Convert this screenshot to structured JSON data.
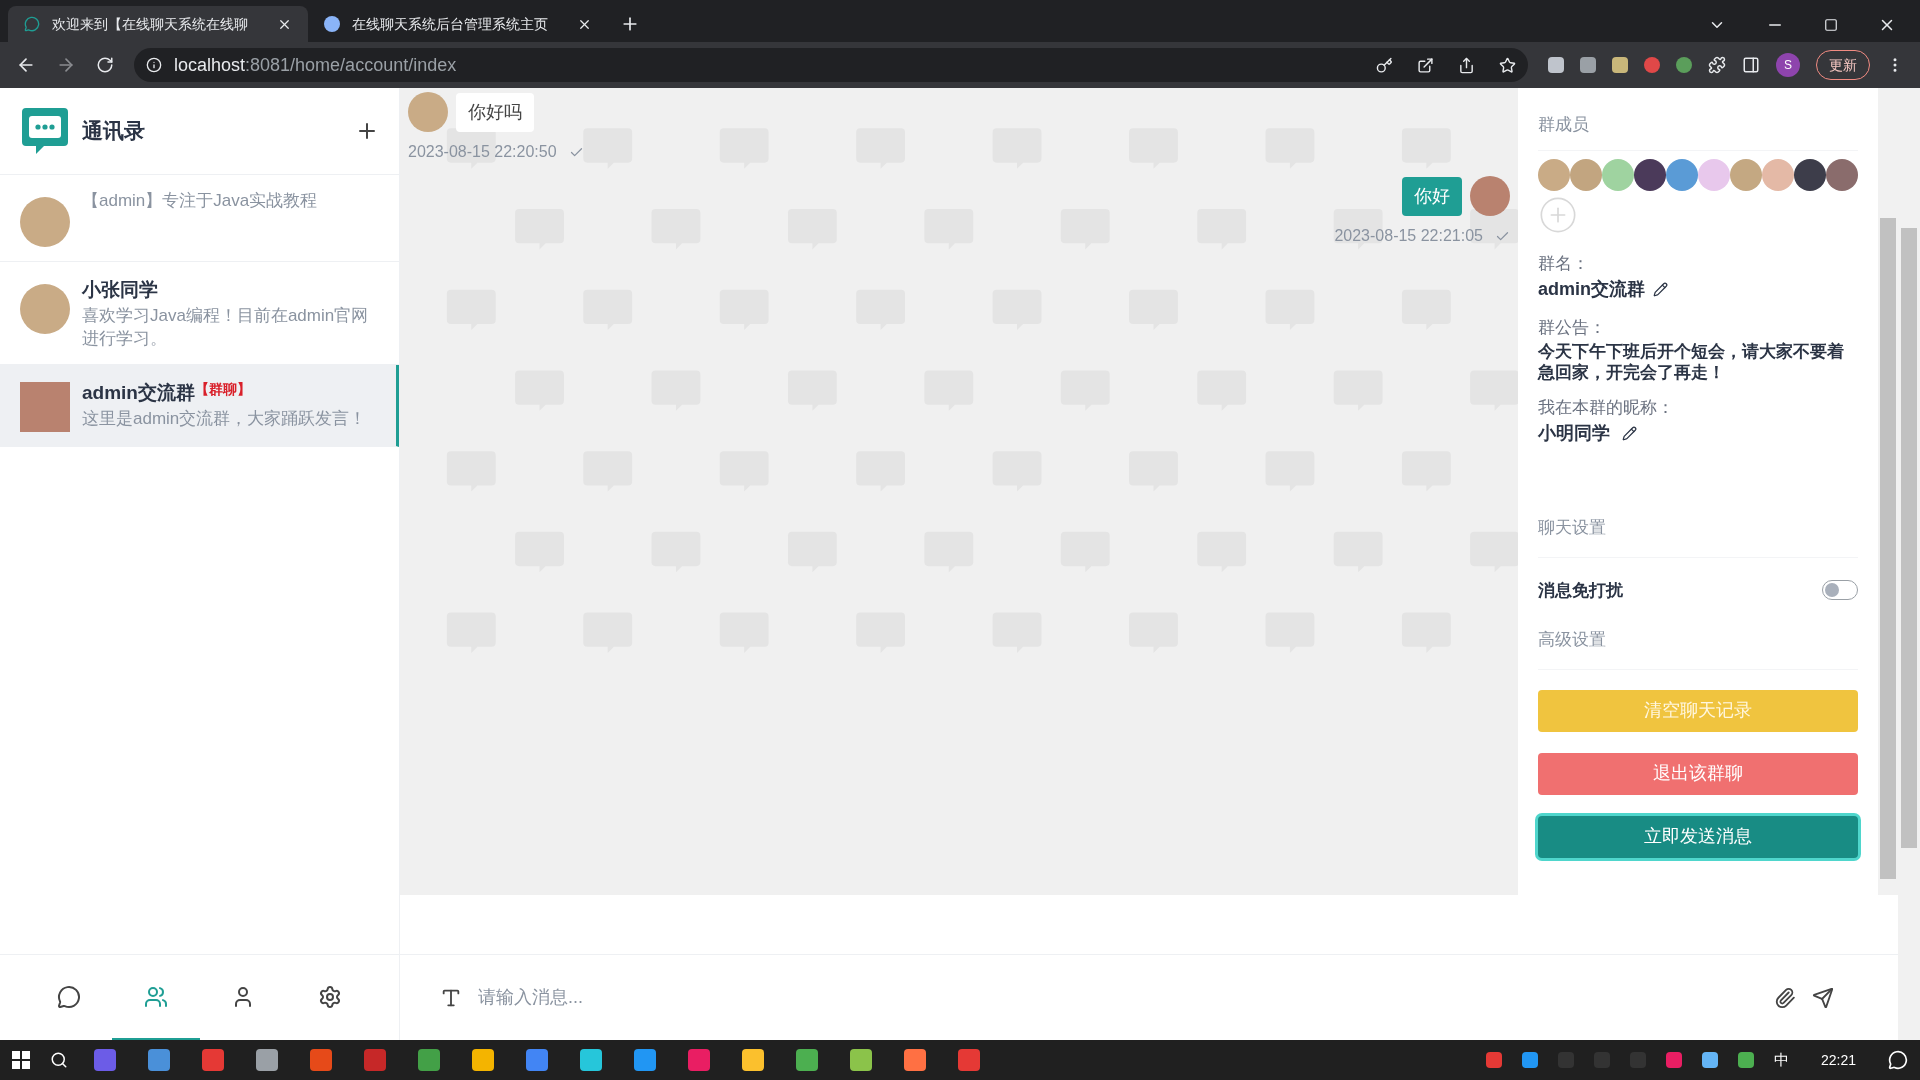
{
  "browser": {
    "tabs": [
      {
        "title": "欢迎来到【在线聊天系统在线聊",
        "selected": true
      },
      {
        "title": "在线聊天系统后台管理系统主页",
        "selected": false
      }
    ],
    "url_host": "localhost",
    "url_rest": ":8081/home/account/index",
    "update_button": "更新",
    "profile_initial": "S"
  },
  "sidebar": {
    "title": "通讯录",
    "contacts": [
      {
        "kind": "person",
        "message": "【admin】专注于Java实战教程",
        "selected": false
      },
      {
        "kind": "person",
        "name": "小张同学",
        "message": "喜欢学习Java编程！目前在admin官网进行学习。",
        "selected": false
      },
      {
        "kind": "group",
        "name": "admin交流群",
        "message": "这里是admin交流群，大家踊跃发言！",
        "tag": "【群聊】",
        "selected": true
      }
    ]
  },
  "chat": {
    "messages": [
      {
        "text": "你好吗",
        "time": "2023-08-15 22:20:50",
        "own": false
      },
      {
        "text": "你好",
        "time": "2023-08-15 22:21:05",
        "own": true
      }
    ]
  },
  "panel": {
    "members_title": "群成员",
    "group_name_label": "群名：",
    "group_name": "admin交流群",
    "notice_label": "群公告：",
    "notice": "今天下午下班后开个短会，请大家不要着急回家，开完会了再走！",
    "nickname_label": "我在本群的昵称：",
    "nickname": "小明同学",
    "chat_settings": "聊天设置",
    "dnd": {
      "label": "消息免打扰",
      "on": false
    },
    "advanced": "高级设置",
    "buttons": [
      {
        "label": "清空聊天记录",
        "kind": "warning"
      },
      {
        "label": "退出该群聊",
        "kind": "danger"
      },
      {
        "label": "立即发送消息",
        "kind": "primary"
      }
    ]
  },
  "nav": [
    {
      "kind": "chat",
      "selected": false
    },
    {
      "kind": "contacts",
      "selected": true
    },
    {
      "kind": "profile",
      "selected": false
    },
    {
      "kind": "settings",
      "selected": false
    }
  ],
  "composer": {
    "placeholder": "请输入消息..."
  },
  "taskbar": {
    "ime": "中",
    "time": "22:21"
  }
}
